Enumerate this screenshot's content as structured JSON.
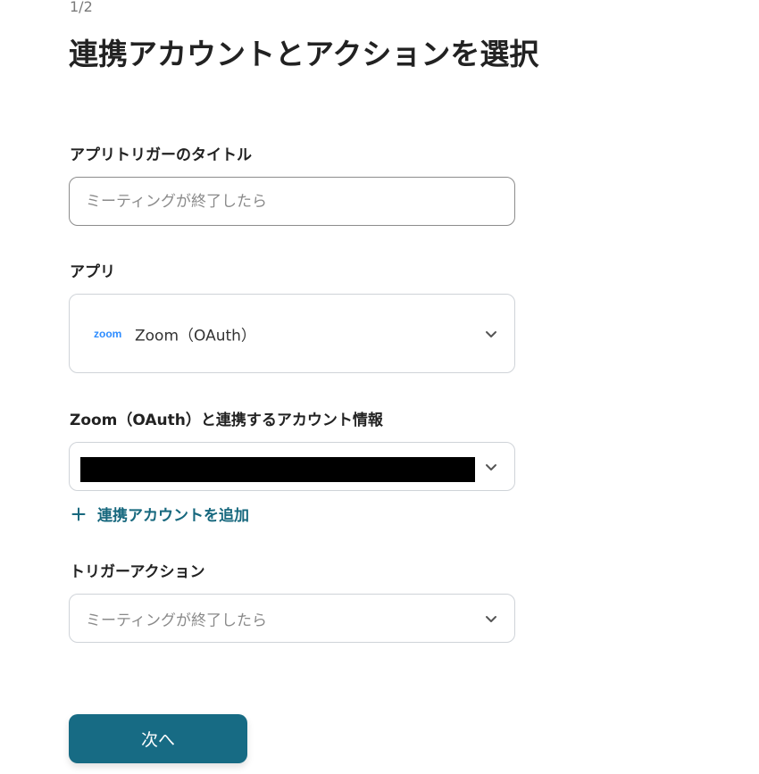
{
  "header": {
    "step": "1/2",
    "title": "連携アカウントとアクションを選択"
  },
  "trigger_title": {
    "label": "アプリトリガーのタイトル",
    "value": "",
    "placeholder": "ミーティングが終了したら"
  },
  "app": {
    "label": "アプリ",
    "logo_text": "zoom",
    "selected": "Zoom（OAuth）",
    "icon": "chevron-down-icon"
  },
  "account": {
    "label": "Zoom（OAuth）と連携するアカウント情報",
    "icon": "chevron-down-icon"
  },
  "add_account": {
    "label": "連携アカウントを追加",
    "icon": "plus-icon"
  },
  "trigger_action": {
    "label": "トリガーアクション",
    "selected": "ミーティングが終了したら",
    "icon": "chevron-down-icon"
  },
  "footer": {
    "next_label": "次へ"
  },
  "colors": {
    "primary": "#176b84",
    "link": "#17687e",
    "zoom_blue": "#2d8cff",
    "border": "#cfd3d8"
  }
}
